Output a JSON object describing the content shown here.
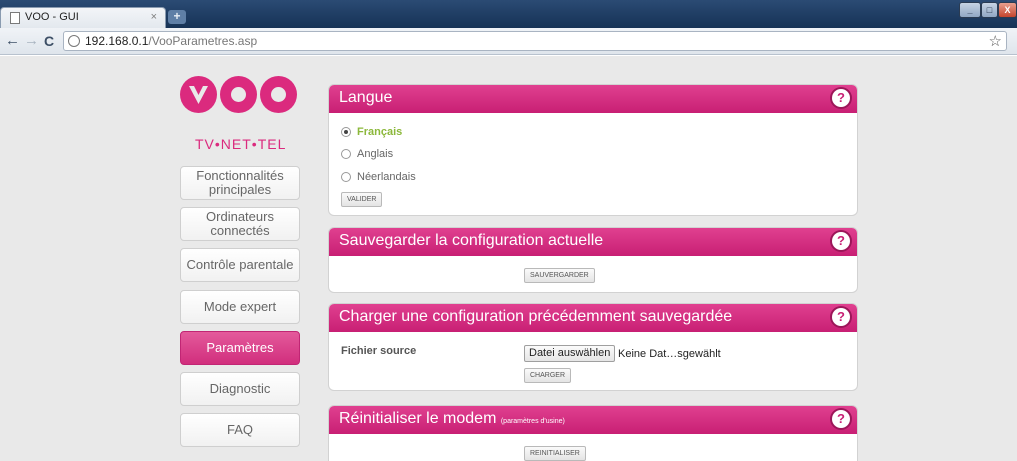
{
  "browser": {
    "tab_title": "VOO - GUI",
    "tab_close": "×",
    "new_tab": "+",
    "url_host": "192.168.0.1",
    "url_path": "/VooParametres.asp",
    "back": "←",
    "forward": "→",
    "reload": "C",
    "bookmark_star": "☆",
    "window_controls": {
      "minimize": "_",
      "maximize": "□",
      "close": "X"
    }
  },
  "logo": {
    "tagline": "TV•NET•TEL"
  },
  "nav": {
    "items": [
      {
        "label": "Fonctionnalités principales",
        "active": false
      },
      {
        "label": "Ordinateurs connectés",
        "active": false
      },
      {
        "label": "Contrôle parentale",
        "active": false
      },
      {
        "label": "Mode expert",
        "active": false
      },
      {
        "label": "Paramètres",
        "active": true
      },
      {
        "label": "Diagnostic",
        "active": false
      },
      {
        "label": "FAQ",
        "active": false
      }
    ]
  },
  "panels": {
    "langue": {
      "title": "Langue",
      "options": [
        "Français",
        "Anglais",
        "Néerlandais"
      ],
      "selected": "Français",
      "button": "VALIDER"
    },
    "sauvegarder": {
      "title": "Sauvegarder la configuration actuelle",
      "button": "SAUVERGARDER"
    },
    "charger": {
      "title": "Charger une configuration précédemment sauvegardée",
      "field_label": "Fichier source",
      "file_button": "Datei auswählen",
      "file_status": "Keine Dat…sgewählt",
      "button": "CHARGER"
    },
    "reinitialiser": {
      "title": "Réinitialiser le modem",
      "subtitle": "(paramètres d'usine)",
      "button": "REINITIALISER"
    },
    "help_icon": "?"
  },
  "colors": {
    "brand_pink": "#db2a7e",
    "selected_option_green": "#8cb83b"
  }
}
